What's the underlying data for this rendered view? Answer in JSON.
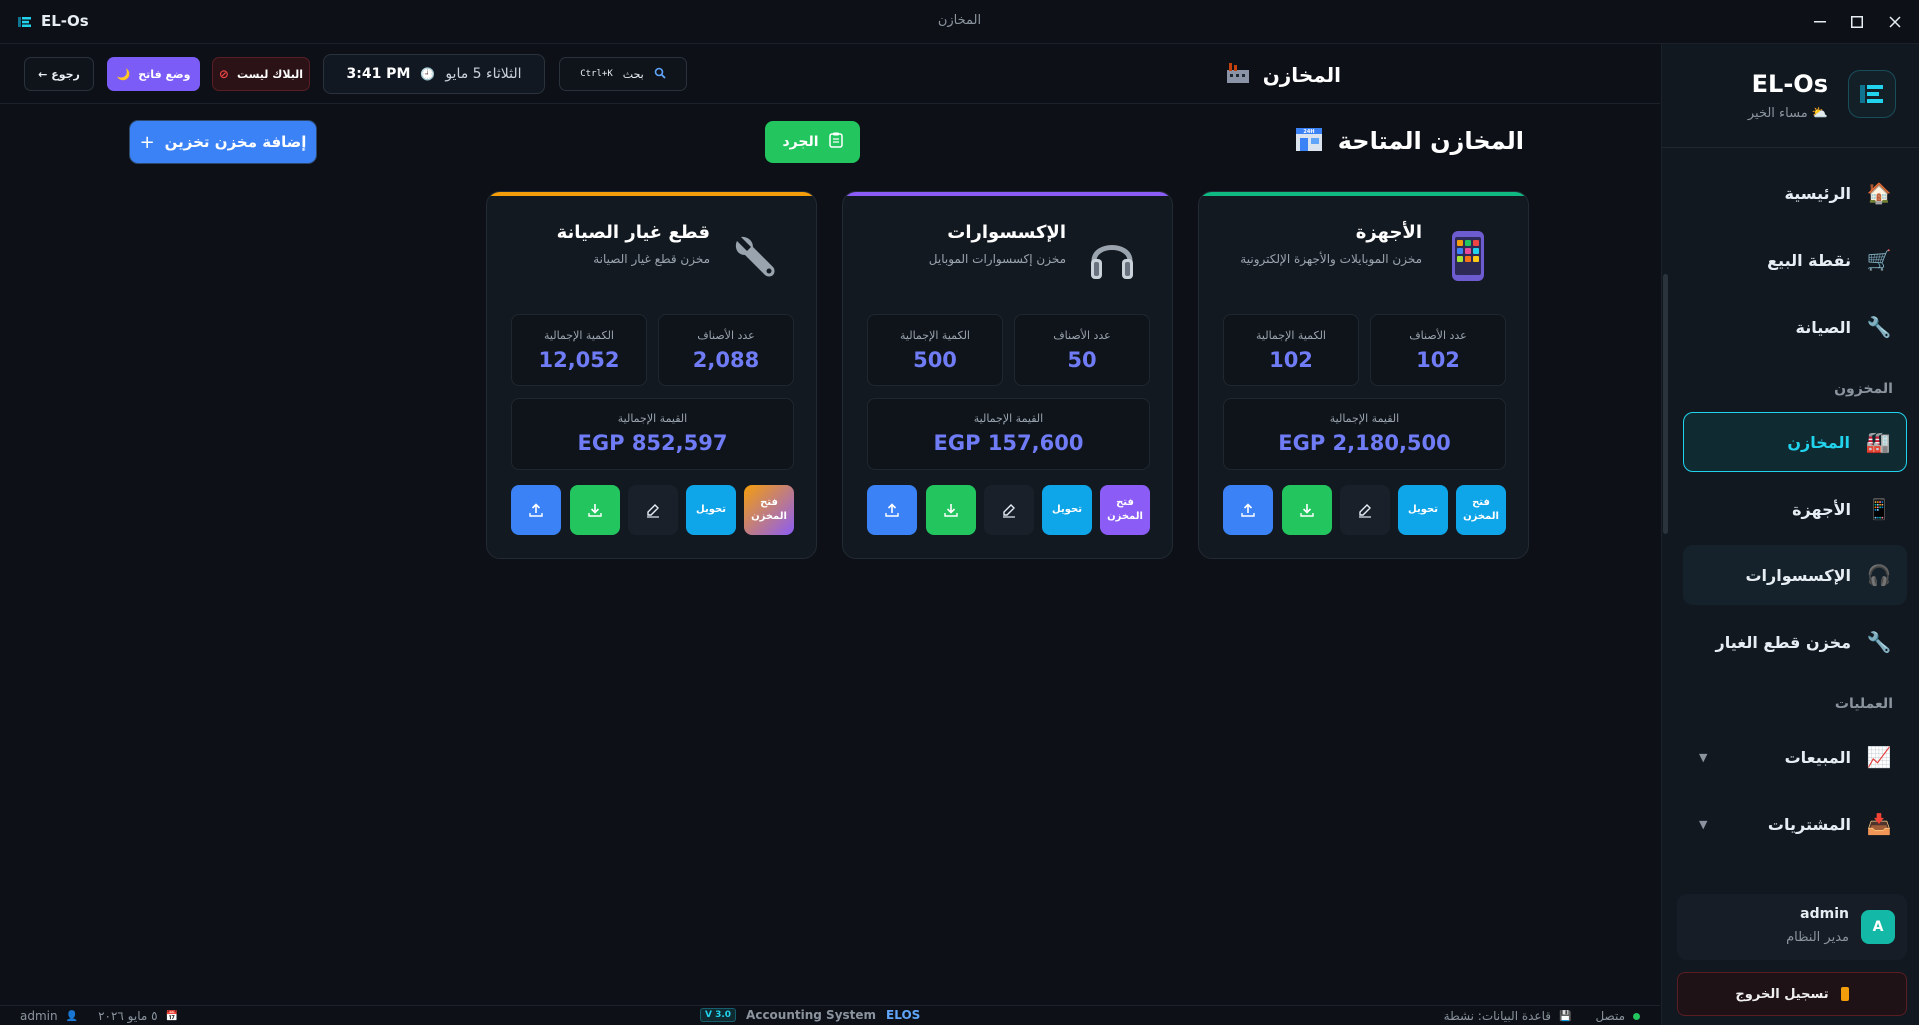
{
  "window": {
    "app_name": "EL-Os",
    "title": "المخازن"
  },
  "header": {
    "page_title": "المخازن",
    "search_label": "بحث",
    "search_shortcut": "Ctrl+K",
    "date": "الثلاثاء 5 مايو",
    "time": "3:41 PM",
    "blacklist_label": "البلاك ليست",
    "theme_label": "وضع فاتح",
    "back_label": "← رجوع"
  },
  "content": {
    "title": "المخازن المتاحة",
    "inventory_label": "الجرد",
    "add_label": "إضافة مخزن تخزين"
  },
  "warehouses": [
    {
      "name": "الأجهزة",
      "desc": "مخزن الموبايلات والأجهزة الإلكترونية",
      "items_label": "عدد الأصناف",
      "items": "102",
      "qty_label": "الكمية الإجمالية",
      "qty": "102",
      "value_label": "القيمة الإجمالية",
      "value": "EGP 2,180,500",
      "open_label": "فتح المخزن",
      "transfer_label": "تحويل",
      "accent": "#10b981",
      "open_color": "#0ea5e9"
    },
    {
      "name": "الإكسسوارات",
      "desc": "مخزن إكسسوارات الموبايل",
      "items_label": "عدد الأصناف",
      "items": "50",
      "qty_label": "الكمية الإجمالية",
      "qty": "500",
      "value_label": "القيمة الإجمالية",
      "value": "EGP 157,600",
      "open_label": "فتح المخزن",
      "transfer_label": "تحويل",
      "accent": "#8b5cf6",
      "open_color": "#8b5cf6"
    },
    {
      "name": "قطع غيار الصيانة",
      "desc": "مخزن قطع غيار الصيانة",
      "items_label": "عدد الأصناف",
      "items": "2,088",
      "qty_label": "الكمية الإجمالية",
      "qty": "12,052",
      "value_label": "القيمة الإجمالية",
      "value": "EGP 852,597",
      "open_label": "فتح المخزن",
      "transfer_label": "تحويل",
      "accent": "#f59e0b",
      "open_color": "#f59e0b"
    }
  ],
  "sidebar": {
    "app_name": "EL-Os",
    "greeting": "مساء الخير",
    "items": [
      {
        "label": "الرئيسية",
        "icon": "house-icon"
      },
      {
        "label": "نقطة البيع",
        "icon": "cart-icon"
      },
      {
        "label": "الصيانة",
        "icon": "wrench-icon"
      },
      {
        "label": "المخازن",
        "icon": "factory-icon"
      },
      {
        "label": "الأجهزة",
        "icon": "phone-icon"
      },
      {
        "label": "الإكسسوارات",
        "icon": "headphones-icon"
      },
      {
        "label": "مخزن قطع الغيار",
        "icon": "wrench-icon"
      },
      {
        "label": "المبيعات",
        "icon": "chart-icon"
      },
      {
        "label": "المشتريات",
        "icon": "inbox-icon"
      }
    ],
    "section_inventory": "المخزون",
    "section_operations": "العمليات",
    "user_name": "admin",
    "user_role": "مدير النظام",
    "user_initial": "A",
    "logout_label": "تسجيل الخروج"
  },
  "statusbar": {
    "user": "admin",
    "date": "٥ مايو ٢٠٢٦",
    "version": "V 3.0",
    "system": "Accounting System",
    "brand": "ELOS",
    "db_status": "قاعدة البيانات: نشطة",
    "connection": "متصل"
  }
}
